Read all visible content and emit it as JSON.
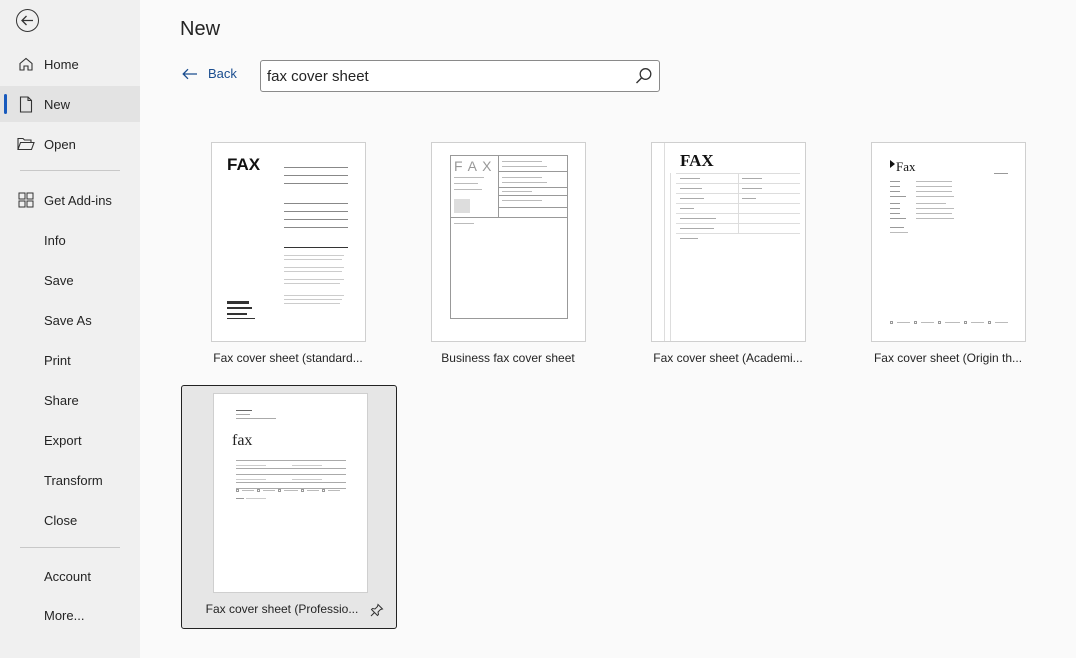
{
  "sidebar": {
    "items": [
      {
        "label": "Home"
      },
      {
        "label": "New"
      },
      {
        "label": "Open"
      },
      {
        "label": "Get Add-ins"
      },
      {
        "label": "Info"
      },
      {
        "label": "Save"
      },
      {
        "label": "Save As"
      },
      {
        "label": "Print"
      },
      {
        "label": "Share"
      },
      {
        "label": "Export"
      },
      {
        "label": "Transform"
      },
      {
        "label": "Close"
      },
      {
        "label": "Account"
      },
      {
        "label": "More..."
      }
    ],
    "active": "New"
  },
  "main": {
    "title": "New",
    "back_label": "Back",
    "search": {
      "value": "fax cover sheet"
    },
    "templates": [
      {
        "name": "Fax cover sheet (standard...",
        "thumb_title": "FAX"
      },
      {
        "name": "Business fax cover sheet",
        "thumb_title": "F A X"
      },
      {
        "name": "Fax cover sheet (Academi...",
        "thumb_title": "FAX"
      },
      {
        "name": "Fax cover sheet (Origin th...",
        "thumb_title": "Fax"
      },
      {
        "name": "Fax cover sheet (Professio...",
        "thumb_title": "fax",
        "selected": true
      }
    ]
  },
  "colors": {
    "accent": "#185abd",
    "sidebar_bg": "#f0f0f0",
    "link": "#1a4d8f"
  }
}
